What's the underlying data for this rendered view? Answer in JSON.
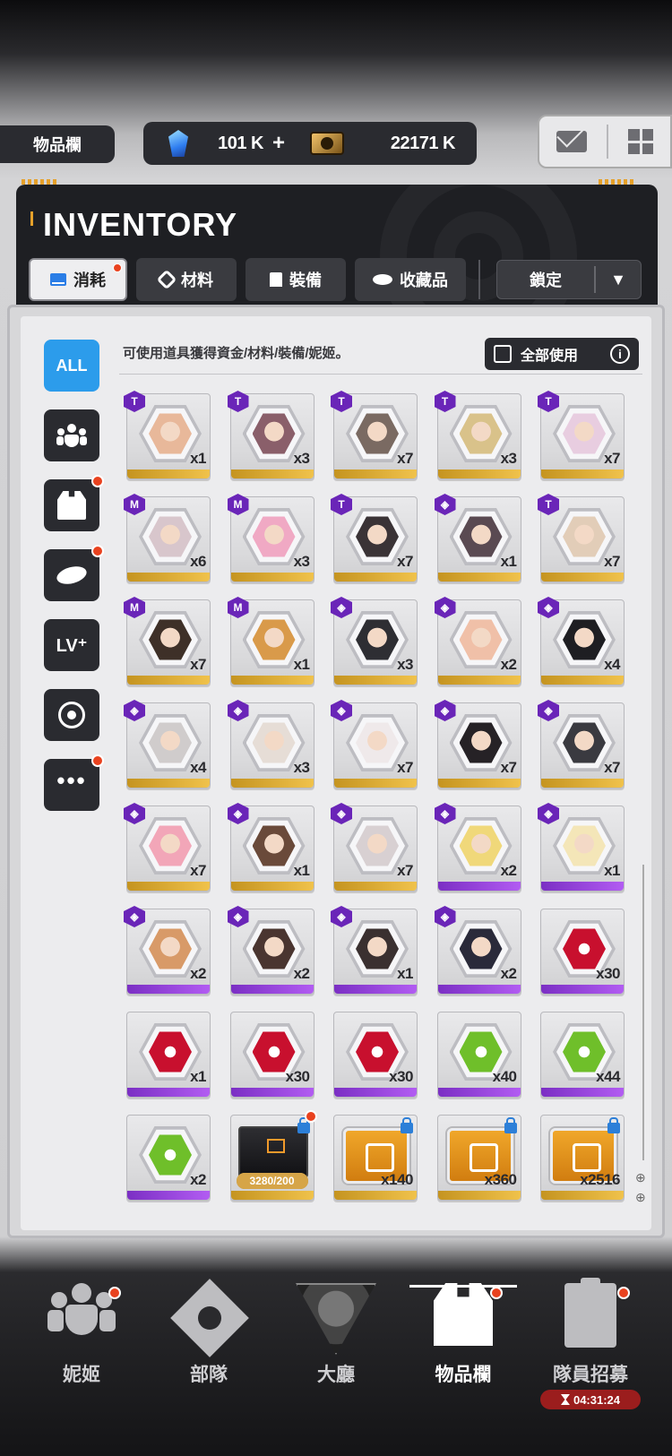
{
  "topbar": {
    "page_name": "物品欄",
    "gems": "101 K",
    "gems_plus": "+",
    "credits": "22171 K",
    "icons": [
      "gem-icon",
      "credit-icon",
      "mail-icon",
      "grid-menu-icon"
    ]
  },
  "inventory": {
    "title": "INVENTORY",
    "tabs": [
      {
        "label": "消耗",
        "icon": "consumable-icon",
        "active": true,
        "notify": true
      },
      {
        "label": "材料",
        "icon": "material-icon",
        "active": false,
        "notify": false
      },
      {
        "label": "裝備",
        "icon": "equipment-icon",
        "active": false,
        "notify": false
      },
      {
        "label": "收藏品",
        "icon": "collection-icon",
        "active": false,
        "notify": false
      }
    ],
    "lock_filter": "鎖定",
    "hint": "可使用道具獲得資金/材料/裝備/妮姬。",
    "use_all": "全部使用",
    "side_filters": [
      {
        "name": "all",
        "label": "ALL"
      },
      {
        "name": "nikke",
        "icon": "people-icon"
      },
      {
        "name": "equipment",
        "icon": "vest-icon",
        "notify": true
      },
      {
        "name": "collection",
        "icon": "planet-icon",
        "notify": true
      },
      {
        "name": "level",
        "label": "LV⁺"
      },
      {
        "name": "target",
        "icon": "target-icon"
      },
      {
        "name": "more",
        "label": "•••",
        "notify": true
      }
    ]
  },
  "items": [
    {
      "qty": "x1",
      "badge": "T",
      "rarity": "gold",
      "kind": "portrait",
      "color": "#e8b89a"
    },
    {
      "qty": "x3",
      "badge": "T",
      "rarity": "gold",
      "kind": "portrait",
      "color": "#8a5f6a"
    },
    {
      "qty": "x7",
      "badge": "T",
      "rarity": "gold",
      "kind": "portrait",
      "color": "#7a6a62"
    },
    {
      "qty": "x3",
      "badge": "T",
      "rarity": "gold",
      "kind": "portrait",
      "color": "#d9c28a"
    },
    {
      "qty": "x7",
      "badge": "T",
      "rarity": "gold",
      "kind": "portrait",
      "color": "#e8cde0"
    },
    {
      "qty": "x6",
      "badge": "M",
      "rarity": "gold",
      "kind": "portrait",
      "color": "#d8c6cc"
    },
    {
      "qty": "x3",
      "badge": "M",
      "rarity": "gold",
      "kind": "portrait",
      "color": "#f0a9c4"
    },
    {
      "qty": "x7",
      "badge": "T",
      "rarity": "gold",
      "kind": "portrait",
      "color": "#3a3336"
    },
    {
      "qty": "x1",
      "badge": "◈",
      "rarity": "gold",
      "kind": "portrait",
      "color": "#5a4a52"
    },
    {
      "qty": "x7",
      "badge": "T",
      "rarity": "gold",
      "kind": "portrait",
      "color": "#e2cdb8"
    },
    {
      "qty": "x7",
      "badge": "M",
      "rarity": "gold",
      "kind": "portrait",
      "color": "#3e3028"
    },
    {
      "qty": "x1",
      "badge": "M",
      "rarity": "gold",
      "kind": "portrait",
      "color": "#d99a4a"
    },
    {
      "qty": "x3",
      "badge": "◈",
      "rarity": "gold",
      "kind": "portrait",
      "color": "#2e2e33"
    },
    {
      "qty": "x2",
      "badge": "◈",
      "rarity": "gold",
      "kind": "portrait",
      "color": "#f0c0a8"
    },
    {
      "qty": "x4",
      "badge": "◈",
      "rarity": "gold",
      "kind": "portrait",
      "color": "#1e1e22"
    },
    {
      "qty": "x4",
      "badge": "◈",
      "rarity": "gold",
      "kind": "portrait",
      "color": "#d0cccc"
    },
    {
      "qty": "x3",
      "badge": "◈",
      "rarity": "gold",
      "kind": "portrait",
      "color": "#e6ddd6"
    },
    {
      "qty": "x7",
      "badge": "◈",
      "rarity": "gold",
      "kind": "portrait",
      "color": "#efe9ea"
    },
    {
      "qty": "x7",
      "badge": "◈",
      "rarity": "gold",
      "kind": "portrait",
      "color": "#262226"
    },
    {
      "qty": "x7",
      "badge": "◈",
      "rarity": "gold",
      "kind": "portrait",
      "color": "#3a3a40"
    },
    {
      "qty": "x7",
      "badge": "◈",
      "rarity": "gold",
      "kind": "portrait",
      "color": "#f2a6b8"
    },
    {
      "qty": "x1",
      "badge": "◈",
      "rarity": "gold",
      "kind": "portrait",
      "color": "#6a4a3a"
    },
    {
      "qty": "x7",
      "badge": "◈",
      "rarity": "gold",
      "kind": "portrait",
      "color": "#d8d0d2"
    },
    {
      "qty": "x2",
      "badge": "◈",
      "rarity": "purple",
      "kind": "portrait",
      "color": "#f0d87a"
    },
    {
      "qty": "x1",
      "badge": "◈",
      "rarity": "purple",
      "kind": "portrait",
      "color": "#f4e6b8"
    },
    {
      "qty": "x2",
      "badge": "◈",
      "rarity": "purple",
      "kind": "portrait",
      "color": "#d89a68"
    },
    {
      "qty": "x2",
      "badge": "◈",
      "rarity": "purple",
      "kind": "portrait",
      "color": "#4a3530"
    },
    {
      "qty": "x1",
      "badge": "◈",
      "rarity": "purple",
      "kind": "portrait",
      "color": "#3a3030"
    },
    {
      "qty": "x2",
      "badge": "◈",
      "rarity": "purple",
      "kind": "portrait",
      "color": "#2a2a3a"
    },
    {
      "qty": "x30",
      "badge": "",
      "rarity": "purple",
      "kind": "emblem",
      "color": "#c8102e"
    },
    {
      "qty": "x1",
      "badge": "",
      "rarity": "purple",
      "kind": "emblem",
      "color": "#c8102e"
    },
    {
      "qty": "x30",
      "badge": "",
      "rarity": "purple",
      "kind": "emblem",
      "color": "#c8102e"
    },
    {
      "qty": "x30",
      "badge": "",
      "rarity": "purple",
      "kind": "emblem",
      "color": "#c8102e"
    },
    {
      "qty": "x40",
      "badge": "",
      "rarity": "purple",
      "kind": "emblem",
      "color": "#6fbf2a"
    },
    {
      "qty": "x44",
      "badge": "",
      "rarity": "purple",
      "kind": "emblem",
      "color": "#6fbf2a"
    },
    {
      "qty": "x2",
      "badge": "",
      "rarity": "purple",
      "kind": "emblem",
      "color": "#6fbf2a"
    },
    {
      "qty": "",
      "badge": "",
      "rarity": "gold",
      "kind": "blackbox",
      "progress": "3280/200",
      "progress_fraction": 1.0,
      "locked": true,
      "notify": true
    },
    {
      "qty": "x140",
      "badge": "",
      "rarity": "gold",
      "kind": "box",
      "locked": true
    },
    {
      "qty": "x360",
      "badge": "",
      "rarity": "gold",
      "kind": "box",
      "locked": true
    },
    {
      "qty": "x2516",
      "badge": "",
      "rarity": "gold",
      "kind": "box",
      "locked": true
    }
  ],
  "bottom_nav": [
    {
      "label": "妮姬",
      "icon": "nikke-icon",
      "notify": true,
      "active": false
    },
    {
      "label": "部隊",
      "icon": "squad-icon",
      "notify": false,
      "active": false
    },
    {
      "label": "大廳",
      "icon": "lobby-icon",
      "notify": false,
      "active": false
    },
    {
      "label": "物品欄",
      "icon": "inventory-vest-icon",
      "notify": true,
      "active": true
    },
    {
      "label": "隊員招募",
      "icon": "recruit-icon",
      "notify": true,
      "active": false,
      "timer": "04:31:24"
    }
  ]
}
